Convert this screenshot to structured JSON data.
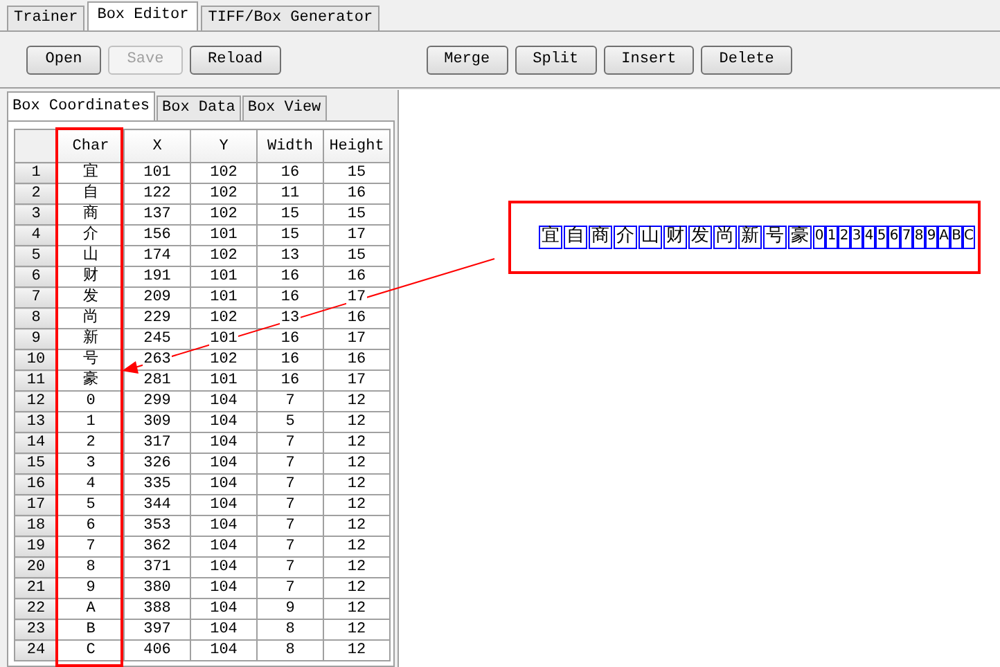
{
  "tabs": [
    {
      "label": "Trainer",
      "selected": false
    },
    {
      "label": "Box Editor",
      "selected": true
    },
    {
      "label": "TIFF/Box Generator",
      "selected": false
    }
  ],
  "toolbar": {
    "left": [
      {
        "label": "Open",
        "disabled": false
      },
      {
        "label": "Save",
        "disabled": true
      },
      {
        "label": "Reload",
        "disabled": false
      }
    ],
    "right": [
      {
        "label": "Merge",
        "disabled": false
      },
      {
        "label": "Split",
        "disabled": false
      },
      {
        "label": "Insert",
        "disabled": false
      },
      {
        "label": "Delete",
        "disabled": false
      }
    ]
  },
  "subtabs": [
    {
      "label": "Box Coordinates",
      "selected": true
    },
    {
      "label": "Box Data",
      "selected": false
    },
    {
      "label": "Box View",
      "selected": false
    }
  ],
  "table": {
    "columns": [
      "Char",
      "X",
      "Y",
      "Width",
      "Height"
    ],
    "rows": [
      {
        "n": "1",
        "cells": [
          "宜",
          "101",
          "102",
          "16",
          "15"
        ]
      },
      {
        "n": "2",
        "cells": [
          "自",
          "122",
          "102",
          "11",
          "16"
        ]
      },
      {
        "n": "3",
        "cells": [
          "商",
          "137",
          "102",
          "15",
          "15"
        ]
      },
      {
        "n": "4",
        "cells": [
          "介",
          "156",
          "101",
          "15",
          "17"
        ]
      },
      {
        "n": "5",
        "cells": [
          "山",
          "174",
          "102",
          "13",
          "15"
        ]
      },
      {
        "n": "6",
        "cells": [
          "财",
          "191",
          "101",
          "16",
          "16"
        ]
      },
      {
        "n": "7",
        "cells": [
          "发",
          "209",
          "101",
          "16",
          "17"
        ]
      },
      {
        "n": "8",
        "cells": [
          "尚",
          "229",
          "102",
          "13",
          "16"
        ]
      },
      {
        "n": "9",
        "cells": [
          "新",
          "245",
          "101",
          "16",
          "17"
        ]
      },
      {
        "n": "10",
        "cells": [
          "号",
          "263",
          "102",
          "16",
          "16"
        ]
      },
      {
        "n": "11",
        "cells": [
          "豪",
          "281",
          "101",
          "16",
          "17"
        ]
      },
      {
        "n": "12",
        "cells": [
          "0",
          "299",
          "104",
          "7",
          "12"
        ]
      },
      {
        "n": "13",
        "cells": [
          "1",
          "309",
          "104",
          "5",
          "12"
        ]
      },
      {
        "n": "14",
        "cells": [
          "2",
          "317",
          "104",
          "7",
          "12"
        ]
      },
      {
        "n": "15",
        "cells": [
          "3",
          "326",
          "104",
          "7",
          "12"
        ]
      },
      {
        "n": "16",
        "cells": [
          "4",
          "335",
          "104",
          "7",
          "12"
        ]
      },
      {
        "n": "17",
        "cells": [
          "5",
          "344",
          "104",
          "7",
          "12"
        ]
      },
      {
        "n": "18",
        "cells": [
          "6",
          "353",
          "104",
          "7",
          "12"
        ]
      },
      {
        "n": "19",
        "cells": [
          "7",
          "362",
          "104",
          "7",
          "12"
        ]
      },
      {
        "n": "20",
        "cells": [
          "8",
          "371",
          "104",
          "7",
          "12"
        ]
      },
      {
        "n": "21",
        "cells": [
          "9",
          "380",
          "104",
          "7",
          "12"
        ]
      },
      {
        "n": "22",
        "cells": [
          "A",
          "388",
          "104",
          "9",
          "12"
        ]
      },
      {
        "n": "23",
        "cells": [
          "B",
          "397",
          "104",
          "8",
          "12"
        ]
      },
      {
        "n": "24",
        "cells": [
          "C",
          "406",
          "104",
          "8",
          "12"
        ]
      }
    ]
  },
  "preview": {
    "glyphs": [
      {
        "text": "宜",
        "kind": "wide"
      },
      {
        "text": "自",
        "kind": "wide"
      },
      {
        "text": "商",
        "kind": "wide"
      },
      {
        "text": "介",
        "kind": "wide"
      },
      {
        "text": "山",
        "kind": "wide"
      },
      {
        "text": "财",
        "kind": "wide"
      },
      {
        "text": "发",
        "kind": "wide"
      },
      {
        "text": "尚",
        "kind": "wide"
      },
      {
        "text": "新",
        "kind": "wide"
      },
      {
        "text": "号",
        "kind": "wide"
      },
      {
        "text": "豪",
        "kind": "wide"
      },
      {
        "text": "0",
        "kind": "narrow"
      },
      {
        "text": "1",
        "kind": "narrow"
      },
      {
        "text": "2",
        "kind": "narrow"
      },
      {
        "text": "3",
        "kind": "narrow"
      },
      {
        "text": "4",
        "kind": "narrow"
      },
      {
        "text": "5",
        "kind": "narrow"
      },
      {
        "text": "6",
        "kind": "narrow"
      },
      {
        "text": "7",
        "kind": "narrow"
      },
      {
        "text": "8",
        "kind": "narrow"
      },
      {
        "text": "9",
        "kind": "narrow"
      },
      {
        "text": "A",
        "kind": "narrow"
      },
      {
        "text": "B",
        "kind": "narrow"
      },
      {
        "text": "C",
        "kind": "narrow"
      }
    ]
  }
}
